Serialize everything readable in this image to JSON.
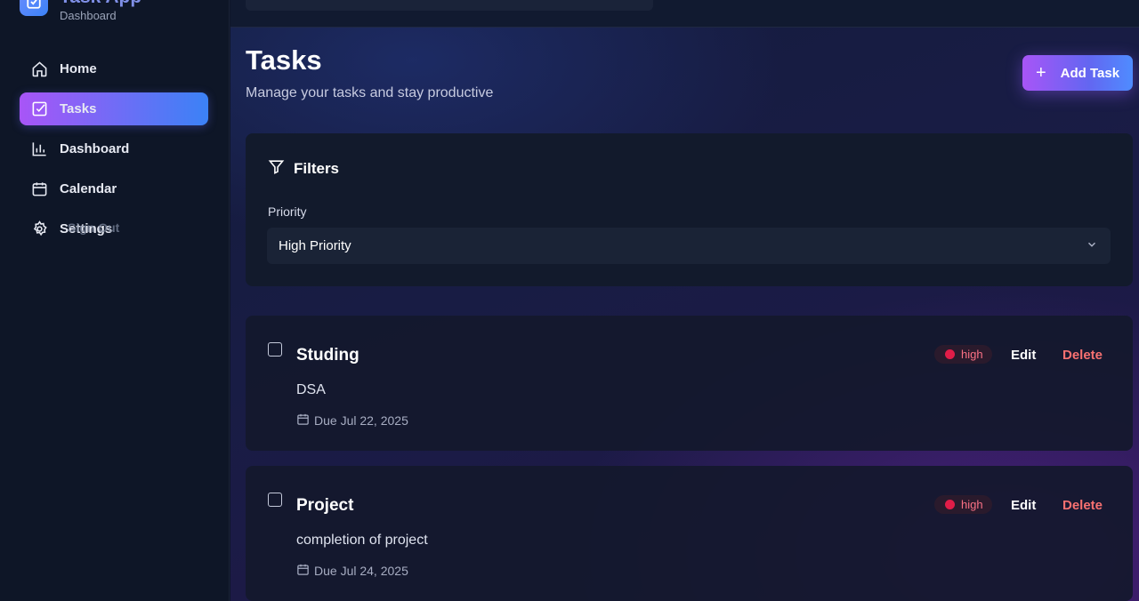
{
  "app": {
    "title": "Task App",
    "subtitle": "Dashboard"
  },
  "sidebar": {
    "items": [
      {
        "label": "Home",
        "icon": "home-icon",
        "active": false
      },
      {
        "label": "Tasks",
        "icon": "checkbox-icon",
        "active": true
      },
      {
        "label": "Dashboard",
        "icon": "bar-chart-icon",
        "active": false
      },
      {
        "label": "Calendar",
        "icon": "calendar-icon",
        "active": false
      },
      {
        "label": "Settings",
        "icon": "gear-icon",
        "active": false
      }
    ],
    "signout": "Sign Out"
  },
  "header": {
    "title": "Tasks",
    "subtitle": "Manage your tasks and stay productive",
    "add_label": "Add Task"
  },
  "filters": {
    "title": "Filters",
    "priority_label": "Priority",
    "priority_value": "High Priority"
  },
  "tasks": [
    {
      "title": "Studing",
      "description": "DSA",
      "due": "Due Jul 22, 2025",
      "priority": "high",
      "edit": "Edit",
      "delete": "Delete"
    },
    {
      "title": "Project",
      "description": "completion of project",
      "due": "Due Jul 24, 2025",
      "priority": "high",
      "edit": "Edit",
      "delete": "Delete"
    }
  ],
  "colors": {
    "accent_start": "#a855f7",
    "accent_end": "#3b82f6",
    "danger": "#f87171",
    "priority_high": "#e11d48"
  }
}
